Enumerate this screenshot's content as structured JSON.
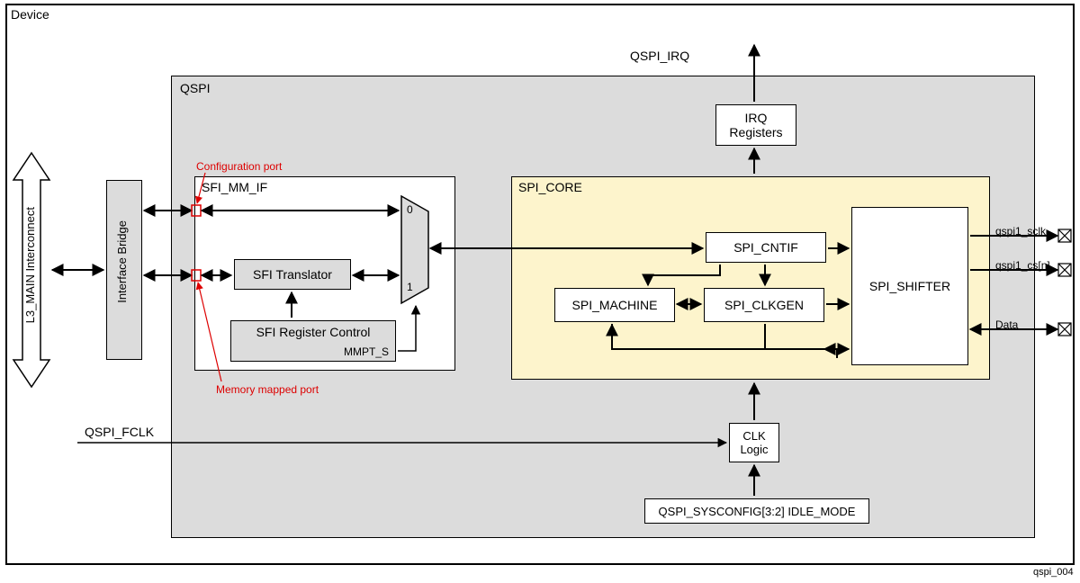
{
  "labels": {
    "device": "Device",
    "qspi": "QSPI",
    "l3_interconnect": "L3_MAIN Interconnect",
    "interface_bridge": "Interface Bridge",
    "sfi_mm_if": "SFI_MM_IF",
    "sfi_translator": "SFI Translator",
    "sfi_reg_ctrl": "SFI Register Control",
    "mmpt_s": "MMPT_S",
    "configuration_port": "Configuration port",
    "memory_mapped_port": "Memory mapped port",
    "mux0": "0",
    "mux1": "1",
    "spi_core": "SPI_CORE",
    "spi_cntif": "SPI_CNTIF",
    "spi_machine": "SPI_MACHINE",
    "spi_clkgen": "SPI_CLKGEN",
    "spi_shifter": "SPI_SHIFTER",
    "irq_registers": "IRQ\nRegisters",
    "qspi_irq": "QSPI_IRQ",
    "qspi_fclk": "QSPI_FCLK",
    "clk_logic": "CLK\nLogic",
    "qspi_sysconfig": "QSPI_SYSCONFIG[3:2] IDLE_MODE",
    "sig_sclk": "qspi1_sclk",
    "sig_csn": "qspi1_cs[n]",
    "sig_data": "Data",
    "figure_ref": "qspi_004"
  }
}
